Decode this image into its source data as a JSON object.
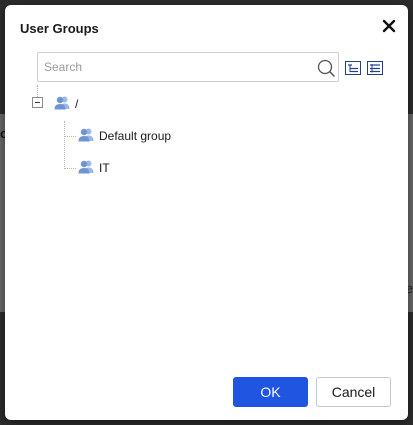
{
  "dialog": {
    "title": "User Groups"
  },
  "search": {
    "placeholder": "Search",
    "value": ""
  },
  "toolbar": {
    "expand_icon": "expand-all-icon",
    "collapse_icon": "collapse-all-icon"
  },
  "tree": {
    "root": {
      "label": "/",
      "expanded": true,
      "icon": "user-group-icon"
    },
    "children": [
      {
        "label": "Default group",
        "icon": "user-group-icon"
      },
      {
        "label": "IT",
        "icon": "user-group-icon"
      }
    ]
  },
  "buttons": {
    "ok_label": "OK",
    "cancel_label": "Cancel"
  },
  "colors": {
    "primary": "#1f55e0",
    "icon_blue": "#7a9fd6"
  }
}
